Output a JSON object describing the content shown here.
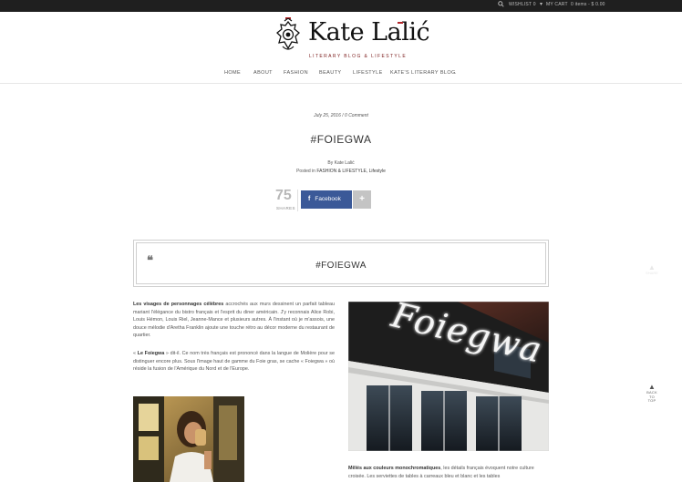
{
  "topbar": {
    "wishlist_label": "WISHLIST",
    "wishlist_count": "0",
    "cart_label": "MY CART",
    "cart_summary": "0 items - $ 0.00"
  },
  "logo": {
    "name": "Kate Lalić",
    "tagline": "LITERARY BLOG & LIFESTYLE"
  },
  "nav": {
    "items": [
      "HOME",
      "ABOUT",
      "FASHION",
      "BEAUTY",
      "LIFESTYLE",
      "KATE'S LITERARY BLOG"
    ]
  },
  "post": {
    "date": "July 25, 2016",
    "comments": "0 Comment",
    "title": "#FOIEGWA",
    "byline": "By Kate Lalić",
    "posted_in_label": "Posted in",
    "categories": "FASHION & LIFESTYLE, Lifestyle"
  },
  "share": {
    "count": "75",
    "label": "SHARES",
    "facebook_label": "Facebook",
    "more_label": "+"
  },
  "quote": {
    "mark": "❝",
    "title": "#FOIEGWA"
  },
  "body": {
    "p1_bold": "Les visages de personnages célèbres",
    "p1_text": " accrochés aux murs dessinent un parfait tableau mariant l'élégance du bistro français et l'esprit du diner américain. J'y reconnais Alice Robi, Louis Hémon, Louis Riel, Jeanne-Mance et plusieurs autres. À l'instant où je m'assois, une douce mélodie d'Aretha Franklin ajoute une touche rétro au décor moderne du restaurant de quartier.",
    "p2_open": "« ",
    "p2_bold": "Le Foiegwa",
    "p2_text": " » dit-il. Ce nom très français est prononcé dans la langue de Molière pour se distinguer encore plus. Sous l'image haut de gamme du Foie gras, se cache « Foiegwa » où réside la fusion de l'Amérique du Nord et de l'Europe.",
    "p3_bold": "Mêlés aux couleurs monochromatiques",
    "p3_text": ", les détails français évoquent notre culture croisée. Les serviettes de tables à carreaux bleu et blanc et les tables"
  },
  "photos": {
    "storefront_sign": "Foiegwa"
  },
  "side": {
    "share_label": "SHARE",
    "back_to_top": [
      "BACK",
      "TO",
      "TOP"
    ]
  },
  "colors": {
    "topbar": "#1f1f1f",
    "accent_red": "#b3262a",
    "facebook": "#3b5998"
  }
}
